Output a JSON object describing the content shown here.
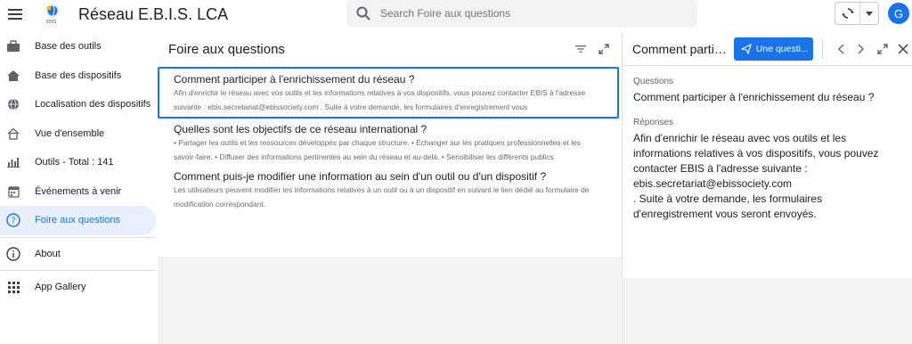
{
  "app": {
    "title": "Réseau E.B.I.S. LCA",
    "logo_text": "EBIS",
    "avatar_letter": "G"
  },
  "search": {
    "placeholder": "Search Foire aux questions"
  },
  "sidebar": {
    "items": [
      {
        "label": "Base des outils",
        "icon": "briefcase-icon"
      },
      {
        "label": "Base des dispositifs",
        "icon": "home-icon"
      },
      {
        "label": "Localisation des dispositifs",
        "icon": "globe-icon"
      },
      {
        "label": "Vue d'ensemble",
        "icon": "home-outline-icon"
      },
      {
        "label": "Outils - Total : 141",
        "icon": "bar-chart-icon"
      },
      {
        "label": "Événements à venir",
        "icon": "calendar-icon"
      },
      {
        "label": "Foire aux questions",
        "icon": "help-circle-icon",
        "active": true
      },
      {
        "label": "About",
        "icon": "info-icon"
      },
      {
        "label": "App Gallery",
        "icon": "grid-icon"
      }
    ]
  },
  "faq_view": {
    "title": "Foire aux questions",
    "items": [
      {
        "question": "Comment participer à l'enrichissement du réseau ?",
        "answer": "Afin d'enrichir le réseau avec vos outils et les informations relatives à vos dispositifs, vous pouvez contacter EBIS à l'adresse suivante : ebis.secretariat@ebissociety.com . Suite à votre demande, les formulaires d'enregistrement vous"
      },
      {
        "question": "Quelles sont les objectifs de ce réseau international ?",
        "answer": "• Partager les outils et les ressources développés par chaque structure. • Échanger sur les pratiques professionnelles et les savoir-faire. • Diffuser des informations pertinentes au sein du réseau et au-delà. • Sensibiliser les différents publics"
      },
      {
        "question": "Comment puis-je modifier une information au sein d'un outil ou d'un dispositif ?",
        "answer": "Les utilisateurs peuvent modifier les informations relatives à un outil ou à un dispositif en suivant le lien dédié au formulaire de modification correspondant."
      }
    ]
  },
  "detail": {
    "title": "Comment participer à l'enrichissement du réseau ?",
    "action_label": "Une questi...",
    "questions_label": "Questions",
    "question_text": "Comment participer à l'enrichissement du réseau ?",
    "answers_label": "Réponses",
    "answer_line1": "Afin d'enrichir le réseau avec vos outils et les informations relatives à vos dispositifs, vous pouvez contacter EBIS à l'adresse suivante :",
    "answer_email": "ebis.secretariat@ebissociety.com",
    "answer_line2": ". Suite à votre demande, les formulaires d'enregistrement vous seront envoyés."
  },
  "colors": {
    "accent": "#1a73e8",
    "active_bg": "#e8f0fe",
    "panel_bg": "#f1f3f4"
  }
}
